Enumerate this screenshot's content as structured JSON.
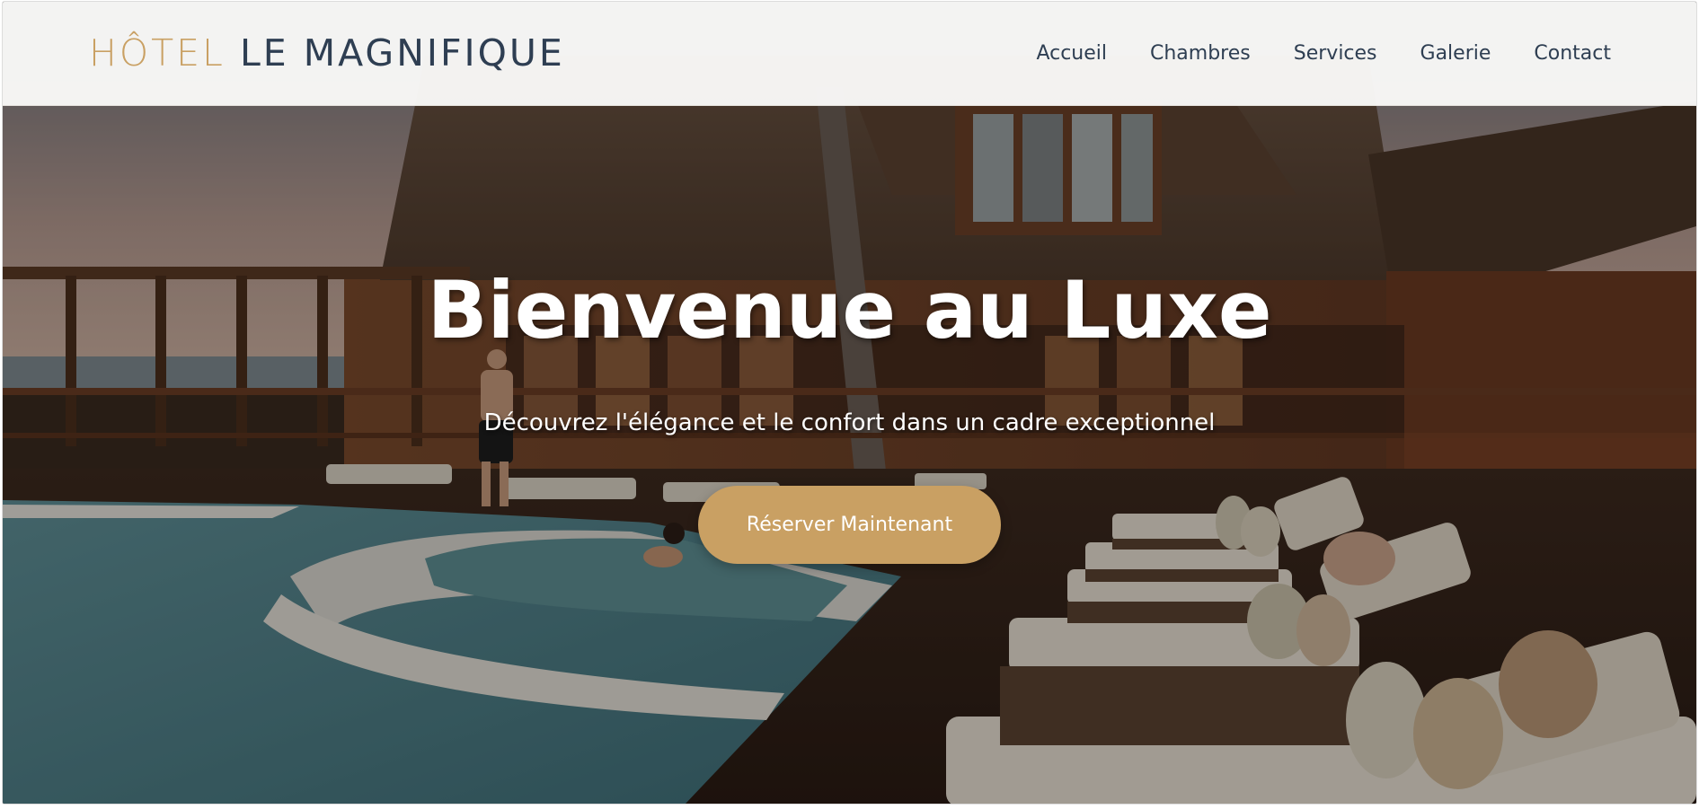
{
  "brand": {
    "logo_part1": "HÔTEL",
    "logo_part2": "LE MAGNIFIQUE",
    "accent_color": "#c9a063",
    "dark_color": "#2e3e52"
  },
  "nav": {
    "items": [
      {
        "label": "Accueil"
      },
      {
        "label": "Chambres"
      },
      {
        "label": "Services"
      },
      {
        "label": "Galerie"
      },
      {
        "label": "Contact"
      }
    ]
  },
  "hero": {
    "title": "Bienvenue au Luxe",
    "subtitle": "Découvrez l'élégance et le confort dans un cadre exceptionnel",
    "cta_label": "Réserver Maintenant",
    "background": "resort-pool-deck-photo"
  }
}
